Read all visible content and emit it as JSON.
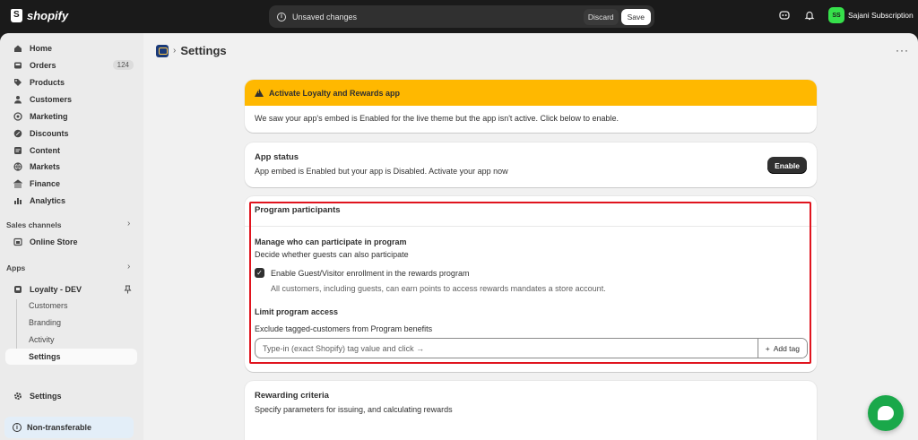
{
  "topbar": {
    "brand": "shopify",
    "unsaved_message": "Unsaved changes",
    "discard_label": "Discard",
    "save_label": "Save",
    "avatar_initials": "SS",
    "store_name": "Sajani Subscription"
  },
  "sidebar": {
    "items": [
      {
        "label": "Home",
        "icon": "home-icon"
      },
      {
        "label": "Orders",
        "icon": "inbox-icon",
        "badge": "124"
      },
      {
        "label": "Products",
        "icon": "tag-icon"
      },
      {
        "label": "Customers",
        "icon": "person-icon"
      },
      {
        "label": "Marketing",
        "icon": "target-icon"
      },
      {
        "label": "Discounts",
        "icon": "discount-icon"
      },
      {
        "label": "Content",
        "icon": "content-icon"
      },
      {
        "label": "Markets",
        "icon": "globe-icon"
      },
      {
        "label": "Finance",
        "icon": "bank-icon"
      },
      {
        "label": "Analytics",
        "icon": "chart-icon"
      }
    ],
    "sales_channels_label": "Sales channels",
    "online_store_label": "Online Store",
    "apps_label": "Apps",
    "app_name": "Loyalty - DEV",
    "app_subitems": [
      "Customers",
      "Branding",
      "Activity",
      "Settings"
    ],
    "settings_label": "Settings",
    "nontransferable_label": "Non-transferable"
  },
  "page": {
    "title": "Settings"
  },
  "banner": {
    "title": "Activate Loyalty and Rewards app",
    "body": "We saw your app's embed is Enabled for the live theme but the app isn't active. Click below to enable."
  },
  "app_status": {
    "title": "App status",
    "text": "App embed is Enabled but your app is Disabled. Activate your app now",
    "enable_label": "Enable"
  },
  "participants": {
    "title": "Program participants",
    "manage_title": "Manage who can participate in program",
    "manage_text": "Decide whether guests can also participate",
    "checkbox_label": "Enable Guest/Visitor enrollment in the rewards program",
    "checkbox_help": "All customers, including guests, can earn points to access rewards mandates a store account.",
    "checkbox_checked": true,
    "limit_title": "Limit program access",
    "limit_text": "Exclude tagged-customers from Program benefits",
    "tag_placeholder": "Type-in (exact Shopify) tag value and click →",
    "add_tag_label": "Add tag"
  },
  "rewarding": {
    "title": "Rewarding criteria",
    "text": "Specify parameters for issuing, and calculating rewards"
  },
  "colors": {
    "banner": "#ffb800",
    "highlight": "#e0141e",
    "chat": "#1aa84a",
    "avatar": "#36e04b"
  }
}
